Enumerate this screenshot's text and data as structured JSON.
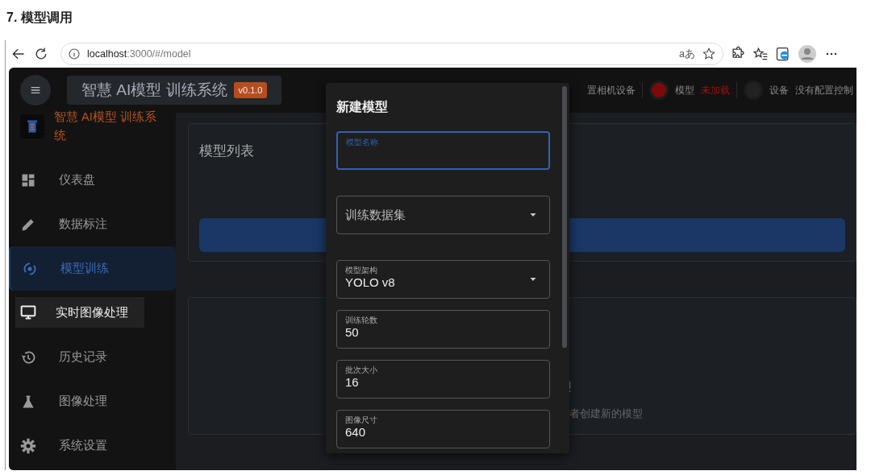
{
  "doc_heading": "7. 模型调用",
  "browser": {
    "url_host": "localhost",
    "url_path": ":3000/#/model",
    "read_aloud": "aあ"
  },
  "header": {
    "title": "智慧 AI模型 训练系统",
    "version": "v0.1.0",
    "status": [
      {
        "value": "置相机设备",
        "alert": false
      },
      {
        "label": "模型",
        "value": "未加载",
        "color": "#7d0a0a",
        "alert": true
      },
      {
        "label": "设备",
        "value": "没有配置控制",
        "color": "#222222",
        "alert": false
      }
    ]
  },
  "sidebar": {
    "brand": "智慧 AI模型 训练系统",
    "items": [
      {
        "kind": "dashboard",
        "label": "仪表盘",
        "selected": false,
        "hovered": false
      },
      {
        "kind": "pencil",
        "label": "数据标注",
        "selected": false,
        "hovered": false
      },
      {
        "kind": "training",
        "label": "模型训练",
        "selected": true,
        "hovered": false
      },
      {
        "kind": "monitor",
        "label": "实时图像处理",
        "selected": false,
        "hovered": true
      },
      {
        "kind": "history",
        "label": "历史记录",
        "selected": false,
        "hovered": false
      },
      {
        "kind": "flask",
        "label": "图像处理",
        "selected": false,
        "hovered": false
      },
      {
        "kind": "gear",
        "label": "系统设置",
        "selected": false,
        "hovered": false
      }
    ]
  },
  "main": {
    "list_card": {
      "title": "模型列表"
    },
    "empty_card": {
      "exclaim": "!",
      "hint": "者创建新的模型"
    }
  },
  "dialog": {
    "title": "新建模型",
    "fields": [
      {
        "kind": "text",
        "label": "模型名称",
        "focused": true
      },
      {
        "kind": "select",
        "label": "训练数据集",
        "focused": false
      },
      {
        "kind": "select",
        "label": "模型架构",
        "value": "YOLO v8",
        "focused": false
      },
      {
        "kind": "text",
        "label": "训练轮数",
        "value": "50",
        "focused": false
      },
      {
        "kind": "text",
        "label": "批次大小",
        "value": "16",
        "focused": false
      },
      {
        "kind": "text",
        "label": "图像尺寸",
        "value": "640",
        "focused": false
      }
    ]
  }
}
